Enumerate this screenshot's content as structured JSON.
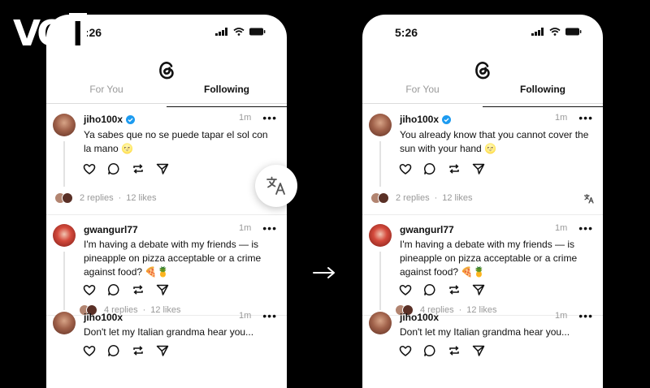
{
  "watermark": {
    "text": "VOI"
  },
  "arrow_icon": "right-arrow",
  "phones": [
    {
      "status_time": "5:26",
      "tabs": [
        "For You",
        "Following"
      ],
      "active_tab": "Following",
      "posts": [
        {
          "username": "jiho100x",
          "verified": true,
          "time": "1m",
          "text": "Ya sabes que no se puede tapar el sol con la mano 🌝",
          "replies": "2 replies",
          "likes": "12 likes"
        },
        {
          "username": "gwangurl77",
          "verified": false,
          "time": "1m",
          "text": "I'm having a debate with my friends — is pineapple on pizza acceptable or a crime against food? 🍕🍍",
          "replies": "4 replies",
          "likes": "12 likes"
        },
        {
          "username": "jiho100x",
          "verified": false,
          "time": "1m",
          "text": "Don't let my Italian grandma hear you..."
        }
      ]
    },
    {
      "status_time": "5:26",
      "tabs": [
        "For You",
        "Following"
      ],
      "active_tab": "Following",
      "posts": [
        {
          "username": "jiho100x",
          "verified": true,
          "time": "1m",
          "text": "You already know that you cannot cover the sun with your hand 🌝",
          "replies": "2 replies",
          "likes": "12 likes"
        },
        {
          "username": "gwangurl77",
          "verified": false,
          "time": "1m",
          "text": "I'm having a debate with my friends — is pineapple on pizza acceptable or a crime against food? 🍕🍍",
          "replies": "4 replies",
          "likes": "12 likes"
        },
        {
          "username": "jiho100x",
          "verified": false,
          "time": "1m",
          "text": "Don't let my Italian grandma hear you..."
        }
      ]
    }
  ],
  "colors": {
    "background": "#000000",
    "verified": "#1d9bf0",
    "muted": "#999999"
  }
}
